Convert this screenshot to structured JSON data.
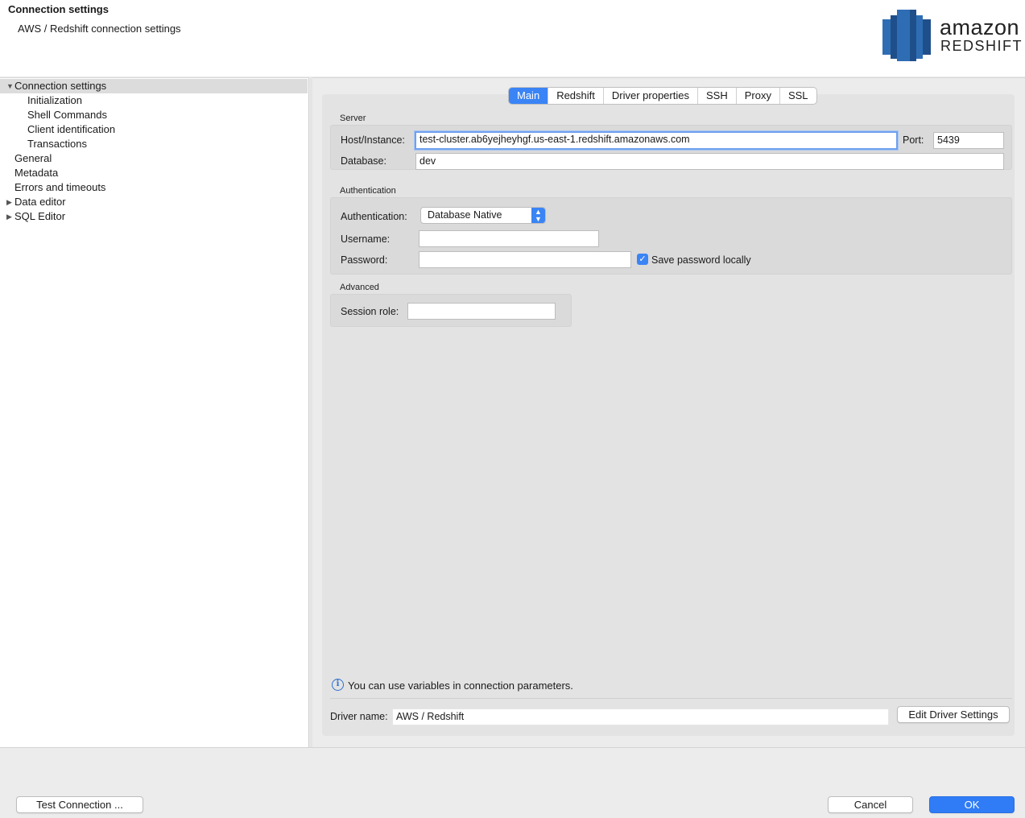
{
  "header": {
    "title": "Connection settings",
    "subtitle": "AWS / Redshift connection settings",
    "logo_line1": "amazon",
    "logo_line2": "REDSHIFT"
  },
  "tree": {
    "root": "Connection settings",
    "children": [
      "Initialization",
      "Shell Commands",
      "Client identification",
      "Transactions"
    ],
    "items": [
      "General",
      "Metadata",
      "Errors and timeouts",
      "Data editor",
      "SQL Editor"
    ]
  },
  "tabs": [
    "Main",
    "Redshift",
    "Driver properties",
    "SSH",
    "Proxy",
    "SSL"
  ],
  "active_tab": "Main",
  "server": {
    "group_label": "Server",
    "host_label": "Host/Instance:",
    "host_value": "test-cluster.ab6yejheyhgf.us-east-1.redshift.amazonaws.com",
    "port_label": "Port:",
    "port_value": "5439",
    "database_label": "Database:",
    "database_value": "dev"
  },
  "authentication": {
    "group_label": "Authentication",
    "auth_label": "Authentication:",
    "auth_value": "Database Native",
    "username_label": "Username:",
    "username_value": "",
    "password_label": "Password:",
    "password_value": "",
    "save_password_label": "Save password locally",
    "save_password_checked": true
  },
  "advanced": {
    "group_label": "Advanced",
    "session_role_label": "Session role:",
    "session_role_value": ""
  },
  "info": {
    "text": "You can use variables in connection parameters."
  },
  "driver": {
    "label": "Driver name:",
    "value": "AWS / Redshift",
    "edit_button": "Edit Driver Settings"
  },
  "footer": {
    "test_button": "Test Connection ...",
    "cancel_button": "Cancel",
    "ok_button": "OK"
  },
  "colors": {
    "accent": "#3a84f5",
    "logo_blue": "#2e6db4"
  }
}
